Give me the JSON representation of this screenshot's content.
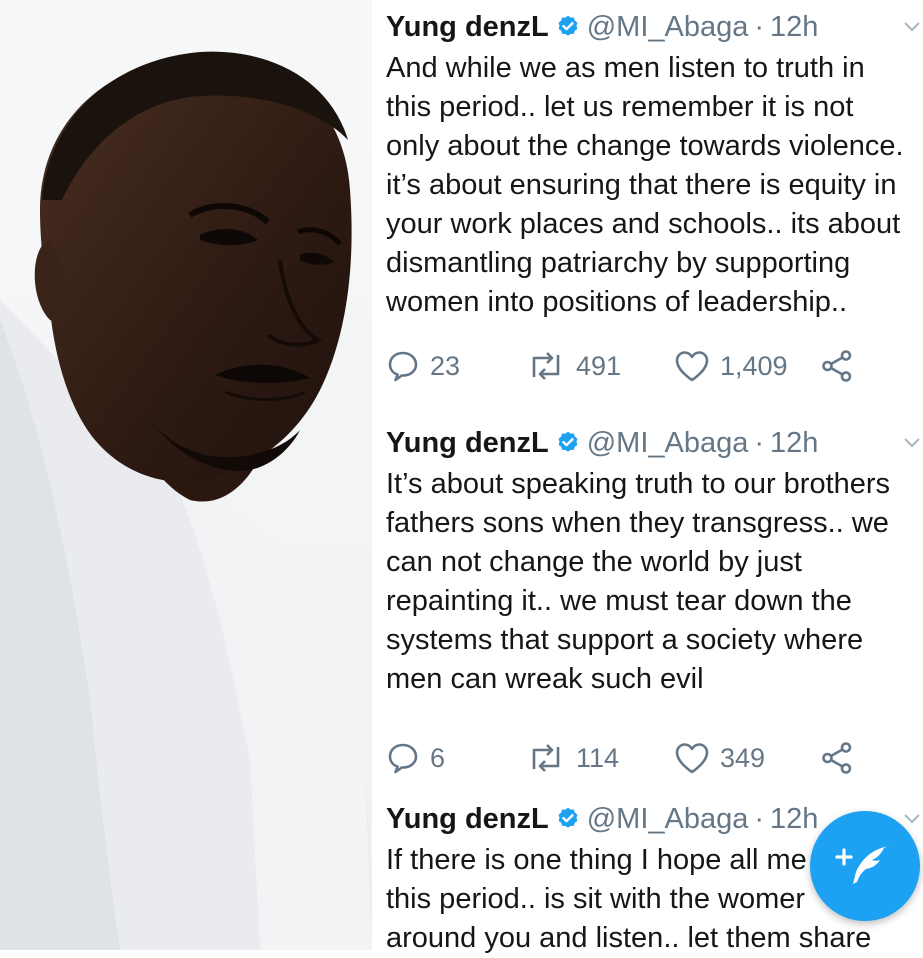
{
  "tweets": [
    {
      "name": "Yung denzL",
      "handle": "@MI_Abaga",
      "separator": "·",
      "time": "12h",
      "lines": [
        "And while we as men listen to truth in",
        "this period.. let us remember it is not",
        "only about the change towards violence.",
        "it’s about ensuring that there is equity in",
        "your work places and schools.. its about",
        "dismantling patriarchy by supporting",
        "women into positions of leadership.."
      ],
      "replies": "23",
      "retweets": "491",
      "likes": "1,409"
    },
    {
      "name": "Yung denzL",
      "handle": "@MI_Abaga",
      "separator": "·",
      "time": "12h",
      "lines": [
        "It’s about speaking truth to our brothers",
        "fathers sons when they transgress.. we",
        "can not change the world by just",
        "repainting it.. we must tear down the",
        "systems that support a society where",
        "men can wreak such evil"
      ],
      "replies": "6",
      "retweets": "114",
      "likes": "349"
    },
    {
      "name": "Yung denzL",
      "handle": "@MI_Abaga",
      "separator": "·",
      "time": "12h",
      "lines": [
        "If there is one thing I hope all me",
        "this period.. is sit with the womer",
        "around you and listen.. let them share"
      ]
    }
  ],
  "colors": {
    "accent": "#1da1f2",
    "text": "#14171a",
    "muted": "#657786"
  },
  "icons": {
    "verified": "verified-badge-icon",
    "reply": "reply-icon",
    "retweet": "retweet-icon",
    "like": "heart-icon",
    "share": "share-icon",
    "compose": "compose-tweet-icon",
    "menu": "chevron-down-icon"
  }
}
